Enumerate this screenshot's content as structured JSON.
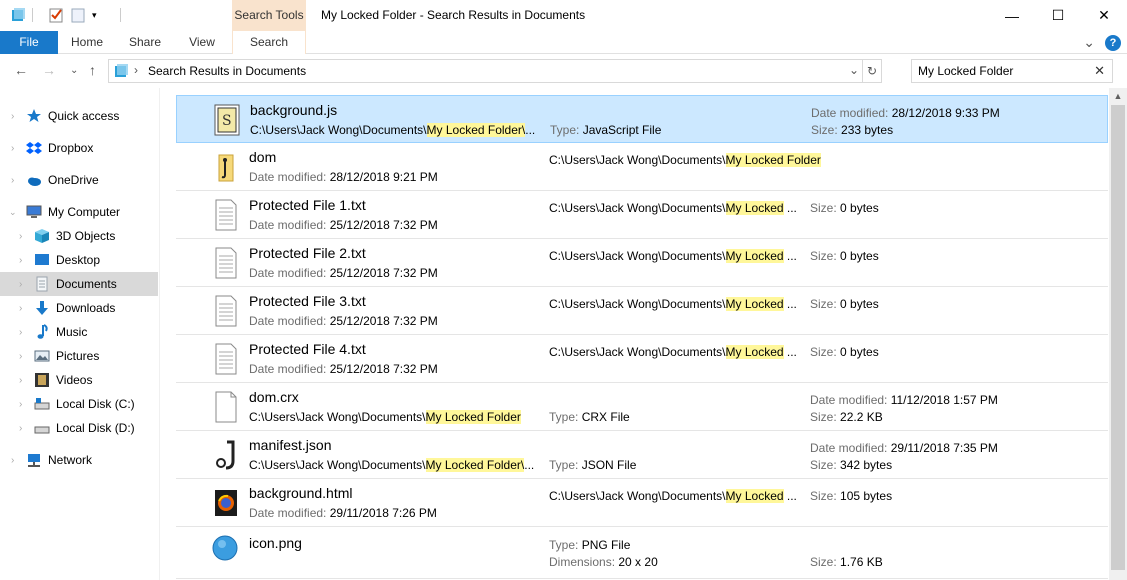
{
  "window": {
    "title": "My Locked Folder - Search Results in Documents",
    "context_tab_group": "Search Tools",
    "minimize": "—",
    "maximize": "☐",
    "close": "✕"
  },
  "ribbon": {
    "tabs": [
      {
        "label": "File"
      },
      {
        "label": "Home"
      },
      {
        "label": "Share"
      },
      {
        "label": "View"
      },
      {
        "label": "Search"
      }
    ],
    "expand_icon": "⌄",
    "help_icon": "?"
  },
  "address": {
    "path": "Search Results in Documents",
    "separator": "›"
  },
  "search": {
    "value": "My Locked Folder",
    "clear": "✕"
  },
  "sidebar": {
    "items": [
      {
        "label": "Quick access",
        "icon": "star-icon",
        "color": "#1979ca"
      },
      {
        "label": "Dropbox",
        "icon": "dropbox-icon",
        "color": "#0061fe"
      },
      {
        "label": "OneDrive",
        "icon": "cloud-icon",
        "color": "#0f6cbd"
      },
      {
        "label": "My Computer",
        "icon": "computer-icon",
        "color": "#3a7bd5"
      },
      {
        "label": "3D Objects",
        "icon": "cube-icon",
        "color": "#33a9d6"
      },
      {
        "label": "Desktop",
        "icon": "desktop-icon",
        "color": "#1e7ad0"
      },
      {
        "label": "Documents",
        "icon": "document-icon",
        "color": "#9aa4ad"
      },
      {
        "label": "Downloads",
        "icon": "download-icon",
        "color": "#1979ca"
      },
      {
        "label": "Music",
        "icon": "music-icon",
        "color": "#1979ca"
      },
      {
        "label": "Pictures",
        "icon": "pictures-icon",
        "color": "#5a6e7f"
      },
      {
        "label": "Videos",
        "icon": "film-icon",
        "color": "#333333"
      },
      {
        "label": "Local Disk (C:)",
        "icon": "drive-c-icon",
        "color": "#666666"
      },
      {
        "label": "Local Disk (D:)",
        "icon": "drive-icon",
        "color": "#666666"
      },
      {
        "label": "Network",
        "icon": "network-icon",
        "color": "#1e7ad0"
      }
    ]
  },
  "labels": {
    "date_modified": "Date modified:",
    "type": "Type:",
    "size": "Size:",
    "dimensions": "Dimensions:"
  },
  "results": [
    {
      "name": "background.js",
      "path_prefix": "C:\\Users\\Jack Wong\\Documents\\",
      "path_hl": "My Locked Folder\\",
      "path_suffix": "...",
      "type": "JavaScript File",
      "date": "28/12/2018 9:33 PM",
      "size": "233 bytes",
      "icon": "javascript-file-icon"
    },
    {
      "name": "dom",
      "date": "28/12/2018 9:21 PM",
      "path_prefix": "C:\\Users\\Jack Wong\\Documents\\",
      "path_hl": "My Locked Folder",
      "icon": "folder-icon"
    },
    {
      "name": "Protected File 1.txt",
      "date": "25/12/2018 7:32 PM",
      "path_prefix": "C:\\Users\\Jack Wong\\Documents\\",
      "path_hl": "My Locked",
      "path_suffix": " ...",
      "size": "0 bytes",
      "icon": "text-file-icon"
    },
    {
      "name": "Protected File 2.txt",
      "date": "25/12/2018 7:32 PM",
      "path_prefix": "C:\\Users\\Jack Wong\\Documents\\",
      "path_hl": "My Locked",
      "path_suffix": " ...",
      "size": "0 bytes",
      "icon": "text-file-icon"
    },
    {
      "name": "Protected File 3.txt",
      "date": "25/12/2018 7:32 PM",
      "path_prefix": "C:\\Users\\Jack Wong\\Documents\\",
      "path_hl": "My Locked",
      "path_suffix": " ...",
      "size": "0 bytes",
      "icon": "text-file-icon"
    },
    {
      "name": "Protected File 4.txt",
      "date": "25/12/2018 7:32 PM",
      "path_prefix": "C:\\Users\\Jack Wong\\Documents\\",
      "path_hl": "My Locked",
      "path_suffix": " ...",
      "size": "0 bytes",
      "icon": "text-file-icon"
    },
    {
      "name": "dom.crx",
      "path_prefix": "C:\\Users\\Jack Wong\\Documents\\",
      "path_hl": "My Locked Folder",
      "type": "CRX File",
      "date": "11/12/2018 1:57 PM",
      "size": "22.2 KB",
      "icon": "blank-file-icon"
    },
    {
      "name": "manifest.json",
      "path_prefix": "C:\\Users\\Jack Wong\\Documents\\",
      "path_hl": "My Locked Folder\\",
      "path_suffix": "...",
      "type": "JSON File",
      "date": "29/11/2018 7:35 PM",
      "size": "342 bytes",
      "icon": "json-file-icon"
    },
    {
      "name": "background.html",
      "date": "29/11/2018 7:26 PM",
      "path_prefix": "C:\\Users\\Jack Wong\\Documents\\",
      "path_hl": "My Locked",
      "path_suffix": " ...",
      "size": "105 bytes",
      "icon": "firefox-html-icon"
    },
    {
      "name": "icon.png",
      "type": "PNG File",
      "dimensions": "20 x 20",
      "size": "1.76 KB",
      "icon": "png-image-icon"
    }
  ]
}
